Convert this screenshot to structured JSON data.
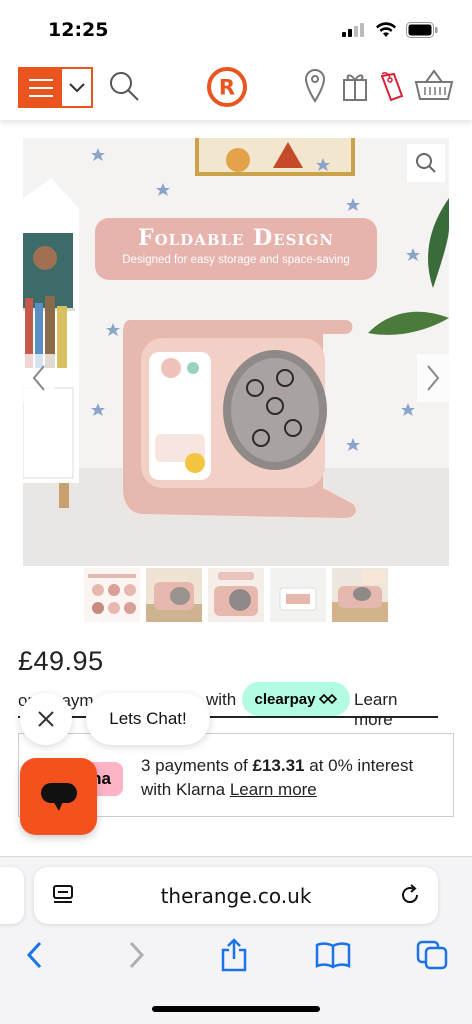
{
  "status": {
    "time": "12:25"
  },
  "header": {
    "menu_icon": "hamburger-icon",
    "search_icon": "search-icon",
    "logo_letter": "R",
    "brand_color": "#e9541f",
    "store_icon": "location-pin-icon",
    "gift_icon": "gift-icon",
    "tag_icon": "tag-icon",
    "basket_icon": "basket-icon"
  },
  "gallery": {
    "banner_title": "Foldable Design",
    "banner_subtitle": "Designed for easy storage and space-saving",
    "thumbnail_count": 5
  },
  "product": {
    "price": "£49.95",
    "clearpay_text": "or 4 paym",
    "clearpay_with": "with",
    "clearpay_brand": "clearpay",
    "clearpay_learn_more": "Learn more",
    "klarna_logo": "na",
    "klarna_pre": "3 payments of ",
    "klarna_amount": "£13.31",
    "klarna_mid": " at 0% interest with Klarna ",
    "klarna_learn_more": "Learn more"
  },
  "chat": {
    "bubble_text": "Lets Chat!"
  },
  "browser": {
    "url": "therange.co.uk"
  },
  "colors": {
    "accent": "#e9541f",
    "clearpay": "#b2fce4",
    "klarna": "#ffb3c7",
    "ios_blue": "#1a73e8"
  }
}
